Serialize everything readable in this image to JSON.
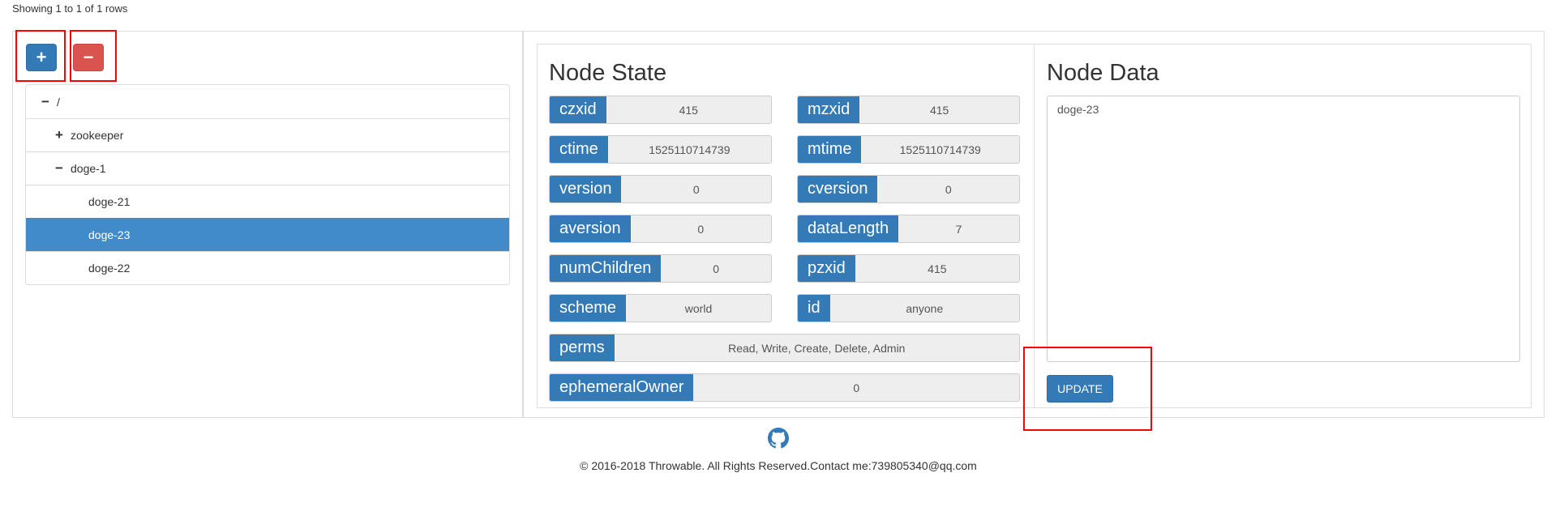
{
  "table_info": "Showing 1 to 1 of 1 rows",
  "toolbar": {
    "add_icon": "plus-icon",
    "add_label": "+",
    "remove_icon": "minus-icon",
    "remove_label": "−"
  },
  "tree": {
    "items": [
      {
        "toggle": "−",
        "label": "/"
      },
      {
        "toggle": "+",
        "label": "zookeeper"
      },
      {
        "toggle": "−",
        "label": "doge-1"
      },
      {
        "toggle": "",
        "label": "doge-21"
      },
      {
        "toggle": "",
        "label": "doge-23",
        "selected": true
      },
      {
        "toggle": "",
        "label": "doge-22"
      }
    ]
  },
  "node_state": {
    "title": "Node State",
    "fields": {
      "czxid": {
        "label": "czxid",
        "value": "415"
      },
      "mzxid": {
        "label": "mzxid",
        "value": "415"
      },
      "ctime": {
        "label": "ctime",
        "value": "1525110714739"
      },
      "mtime": {
        "label": "mtime",
        "value": "1525110714739"
      },
      "version": {
        "label": "version",
        "value": "0"
      },
      "cversion": {
        "label": "cversion",
        "value": "0"
      },
      "aversion": {
        "label": "aversion",
        "value": "0"
      },
      "dataLength": {
        "label": "dataLength",
        "value": "7"
      },
      "numChildren": {
        "label": "numChildren",
        "value": "0"
      },
      "pzxid": {
        "label": "pzxid",
        "value": "415"
      },
      "scheme": {
        "label": "scheme",
        "value": "world"
      },
      "id": {
        "label": "id",
        "value": "anyone"
      },
      "perms": {
        "label": "perms",
        "value": "Read, Write, Create, Delete, Admin"
      },
      "ephemeralOwner": {
        "label": "ephemeralOwner",
        "value": "0"
      }
    }
  },
  "node_data": {
    "title": "Node Data",
    "value": "doge-23",
    "update_label": "UPDATE"
  },
  "footer": {
    "github_icon": "github-icon",
    "text": "© 2016-2018 Throwable. All Rights Reserved.Contact me:739805340@qq.com"
  },
  "colors": {
    "primary": "#337ab7",
    "danger": "#d9534f",
    "selected": "#428bca",
    "annotation_red": "#ff0000"
  }
}
